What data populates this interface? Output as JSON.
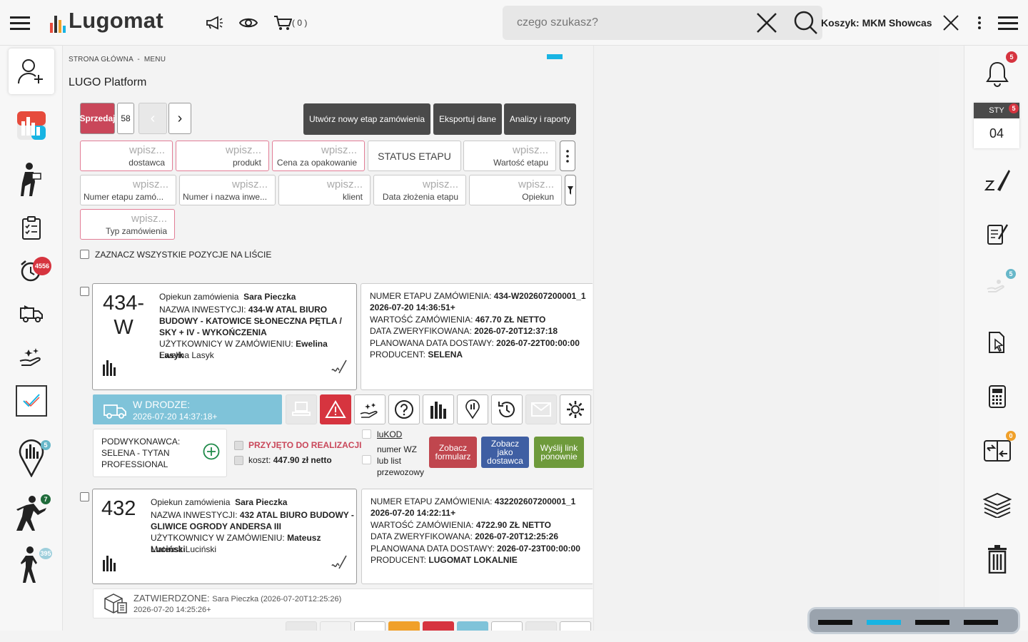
{
  "topbar": {
    "logo_text": "Lugomat",
    "cart_count": "( 0 )",
    "search_placeholder": "czego szukasz?",
    "cart_label": "Koszyk: MKM Showcase"
  },
  "leftnav": {
    "badges": {
      "alarm": "4556",
      "map": "5",
      "person": "7",
      "walker": "395"
    }
  },
  "rightnav": {
    "bell_badge": "5",
    "calendar_month": "STY",
    "calendar_day": "04",
    "calendar_badge": "5",
    "hand_badge": "5",
    "exchange_badge": "0"
  },
  "breadcrumb": {
    "home": "STRONA GŁÓWNA",
    "sep": "-",
    "current": "MENU"
  },
  "page_title": "LUGO Platform",
  "toolbar": {
    "sell_label": "Sprzedaj",
    "count": "58",
    "prev": "‹",
    "next": "›",
    "create_stage": "Utwórz nowy etap zamówienia",
    "export": "Eksportuj dane",
    "analyses": "Analizy i raporty"
  },
  "filters": {
    "placeholder": "wpisz...",
    "row1": [
      "dostawca",
      "produkt",
      "Cena za opakowanie"
    ],
    "status_label": "STATUS ETAPU",
    "value_label": "Wartość etapu",
    "row2": [
      "Numer etapu zamó...",
      "Numer i nazwa inwe...",
      "klient",
      "Data złożenia etapu",
      "Opiekun"
    ],
    "row3": [
      "Typ zamówienia"
    ]
  },
  "select_all_label": "ZAZNACZ WSZYSTKIE POZYCJE NA LIŚCIE",
  "orders": [
    {
      "number_top": "434-",
      "number_bottom": "W",
      "opiekun_label": "Opiekun zamówienia",
      "opiekun": "Sara Pieczka",
      "investment_label": "NAZWA INWESTYCJI:",
      "investment": "434-W ATAL BIURO BUDOWY - KATOWICE SŁONECZNA PĘTLA / SKY + IV - WYKOŃCZENIA",
      "users_label": "UŻYTKOWNICY W ZAMÓWIENIU:",
      "users": "Ewelina Lasyk",
      "users_extra": "Ewelina Lasyk",
      "stage_number_label": "NUMER ETAPU ZAMÓWIENIA:",
      "stage_number": "434-W202607200001_1",
      "stage_date": "2026-07-20 14:36:51+",
      "value_label": "WARTOŚĆ ZAMÓWIENIA:",
      "value": "467.70 ZŁ NETTO",
      "verified_label": "DATA ZWERYFIKOWANA:",
      "verified": "2026-07-20T12:37:18",
      "delivery_label": "PLANOWANA DATA DOSTAWY:",
      "delivery": "2026-07-22T00:00:00",
      "producer_label": "PRODUCENT:",
      "producer": "SELENA",
      "status_title": "W DRODZE:",
      "status_date": "2026-07-20 14:37:18+",
      "subcontractor_label": "PODWYKONAWCA:",
      "subcontractor": "SELENA - TYTAN PROFESSIONAL",
      "accepted": "PRZYJĘTO DO REALIZACJI",
      "cost_label": "koszt:",
      "cost": "447.90 zł netto",
      "lukod": "luKOD",
      "wz_text": "numer WZ lub list przewozowy",
      "btn_form": "Zobacz formularz",
      "btn_supplier": "Zobacz jako dostawca",
      "btn_resend": "Wyślij link ponownie"
    },
    {
      "number_top": "432",
      "opiekun_label": "Opiekun zamówienia",
      "opiekun": "Sara Pieczka",
      "investment_label": "NAZWA INWESTYCJI:",
      "investment": "432 ATAL BIURO BUDOWY - GLIWICE OGRODY ANDERSA III",
      "users_label": "UŻYTKOWNICY W ZAMÓWIENIU:",
      "users": "Mateusz Luciński",
      "users_extra": "Mateusz Luciński",
      "stage_number_label": "NUMER ETAPU ZAMÓWIENIA:",
      "stage_number": "432202607200001_1",
      "stage_date": "2026-07-20 14:22:11+",
      "value_label": "WARTOŚĆ ZAMÓWIENIA:",
      "value": "4722.90 ZŁ NETTO",
      "verified_label": "DATA ZWERYFIKOWANA:",
      "verified": "2026-07-20T12:25:26",
      "delivery_label": "PLANOWANA DATA DOSTAWY:",
      "delivery": "2026-07-23T00:00:00",
      "producer_label": "PRODUCENT:",
      "producer": "LUGOMAT LOKALNIE",
      "status_title": "ZATWIERDZONE:",
      "status_by": "Sara Pieczka (2026-07-20T12:25:26)",
      "status_date": "2026-07-20 14:25:26+"
    }
  ],
  "colors": {
    "accent_cyan": "#18b4e3",
    "status_transit": "#7fc3d9",
    "danger": "#d6343f",
    "sell_red": "#c9475a",
    "form_btn": "#c0464e",
    "supplier_btn": "#3f5fa3",
    "resend_btn": "#6e9a3b"
  }
}
